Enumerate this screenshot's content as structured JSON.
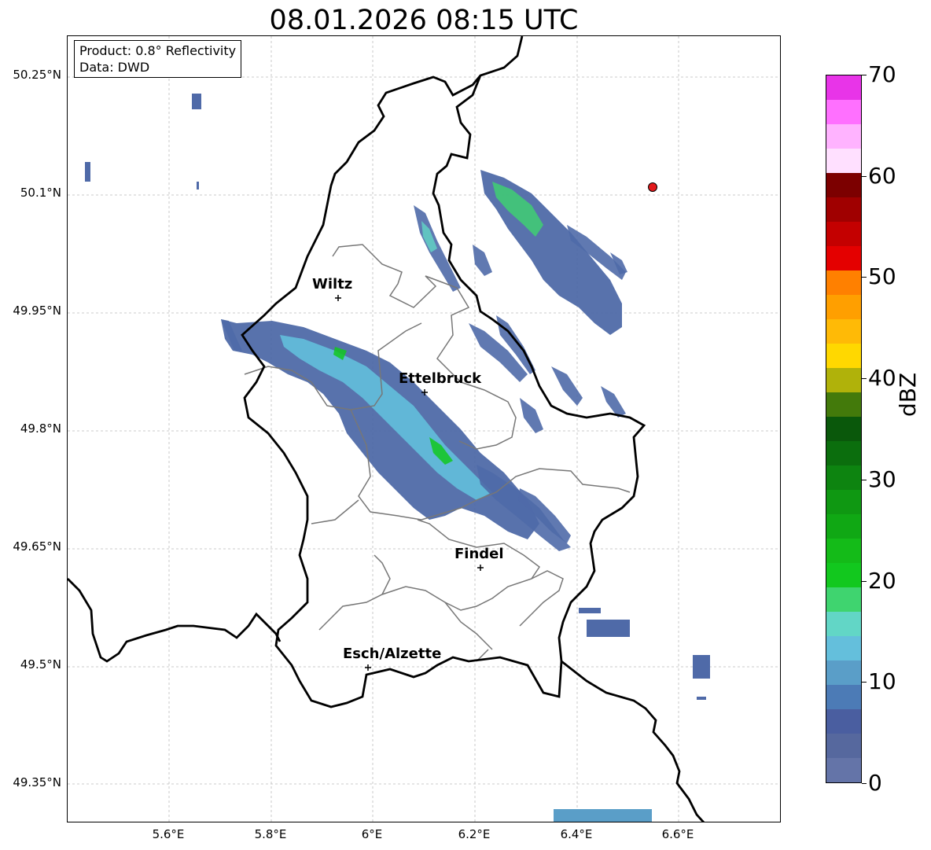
{
  "title": "08.01.2026 08:15 UTC",
  "info": {
    "product": "Product: 0.8° Reflectivity",
    "source": "Data: DWD"
  },
  "axes": {
    "lat_ticks": [
      "50.25°N",
      "50.1°N",
      "49.95°N",
      "49.8°N",
      "49.65°N",
      "49.5°N",
      "49.35°N"
    ],
    "lon_ticks": [
      "5.6°E",
      "5.8°E",
      "6°E",
      "6.2°E",
      "6.4°E",
      "6.6°E"
    ]
  },
  "cities": [
    {
      "name": "Wiltz"
    },
    {
      "name": "Ettelbruck"
    },
    {
      "name": "Findel"
    },
    {
      "name": "Esch/Alzette"
    }
  ],
  "marker": {
    "color": "#e31a1c"
  },
  "colorbar": {
    "label": "dBZ",
    "ticks": [
      "0",
      "10",
      "20",
      "30",
      "40",
      "50",
      "60",
      "70"
    ],
    "colors": [
      "#6474a8",
      "#56689e",
      "#4a5ea0",
      "#4c7bb6",
      "#5a9ec8",
      "#64bfdc",
      "#62d6c6",
      "#3fd46f",
      "#12c81e",
      "#14bb18",
      "#10a814",
      "#0f9812",
      "#0d8410",
      "#0b6e0d",
      "#0a580b",
      "#437a0b",
      "#b0b20a",
      "#ffd800",
      "#ffba06",
      "#ff9f00",
      "#ff8000",
      "#e40000",
      "#c40000",
      "#a00000",
      "#7c0000",
      "#ffe0ff",
      "#ffb3ff",
      "#ff70ff",
      "#e834e8"
    ]
  }
}
